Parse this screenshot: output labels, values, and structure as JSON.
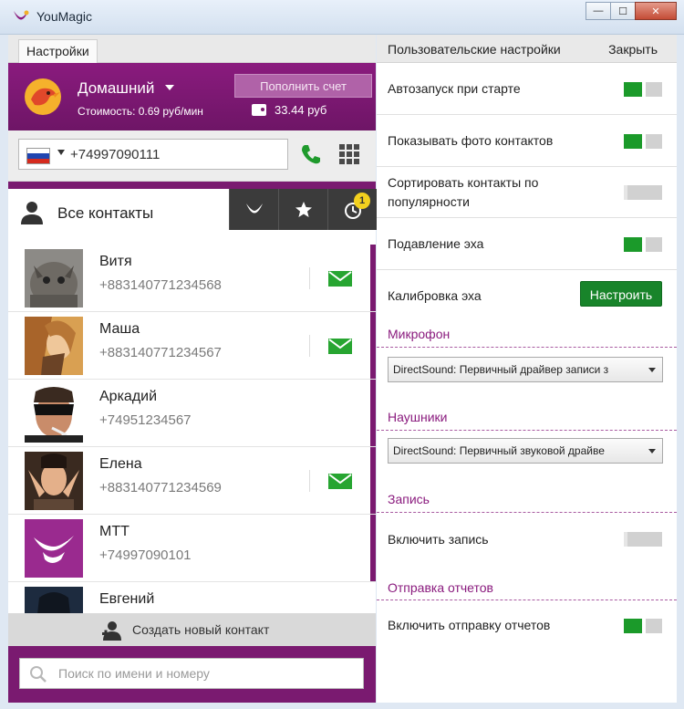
{
  "window": {
    "title": "YouMagic",
    "minimize": "—",
    "maximize": "☐",
    "close": "✕"
  },
  "left_tab": "Настройки",
  "account": {
    "plan_name": "Домашний",
    "cost": "Стоимость: 0.69 руб/мин",
    "topup_label": "Пополнить счет",
    "balance": "33.44 руб"
  },
  "dialer": {
    "phone": "+74997090111"
  },
  "contacts_tab": {
    "all_label": "Все контакты",
    "missed_badge": "1"
  },
  "contacts": [
    {
      "name": "Витя",
      "phone": "+883140771234568",
      "has_message": true
    },
    {
      "name": "Маша",
      "phone": "+883140771234567",
      "has_message": true
    },
    {
      "name": "Аркадий",
      "phone": "+74951234567",
      "has_message": false
    },
    {
      "name": "Елена",
      "phone": "+883140771234569",
      "has_message": true
    },
    {
      "name": "МТТ",
      "phone": "+74997090101",
      "has_message": false
    },
    {
      "name": "Евгений",
      "phone": "",
      "has_message": false
    }
  ],
  "create_contact_label": "Создать новый контакт",
  "search": {
    "placeholder": "Поиск по имени и номеру"
  },
  "settings": {
    "header_tab": "Пользовательские настройки",
    "close_label": "Закрыть",
    "autostart": {
      "label": "Автозапуск при старте",
      "on": true
    },
    "show_photos": {
      "label": "Показывать фото контактов",
      "on": true
    },
    "sort_popular": {
      "label_line1": "Сортировать контакты по",
      "label_line2": "популярности",
      "on": false
    },
    "echo_cancel": {
      "label": "Подавление эха",
      "on": true
    },
    "echo_calibration": {
      "label": "Калибровка эха",
      "button": "Настроить"
    },
    "microphone": {
      "title": "Микрофон",
      "selected": "DirectSound: Первичный драйвер записи з"
    },
    "headphones": {
      "title": "Наушники",
      "selected": "DirectSound: Первичный звуковой драйве"
    },
    "recording": {
      "title": "Запись",
      "enable_label": "Включить запись",
      "on": false
    },
    "reports": {
      "title": "Отправка отчетов",
      "enable_label": "Включить отправку отчетов",
      "on": true
    }
  },
  "colors": {
    "brand_purple": "#7a1a70",
    "toggle_green": "#1b9a2a",
    "mail_green": "#27a531"
  }
}
